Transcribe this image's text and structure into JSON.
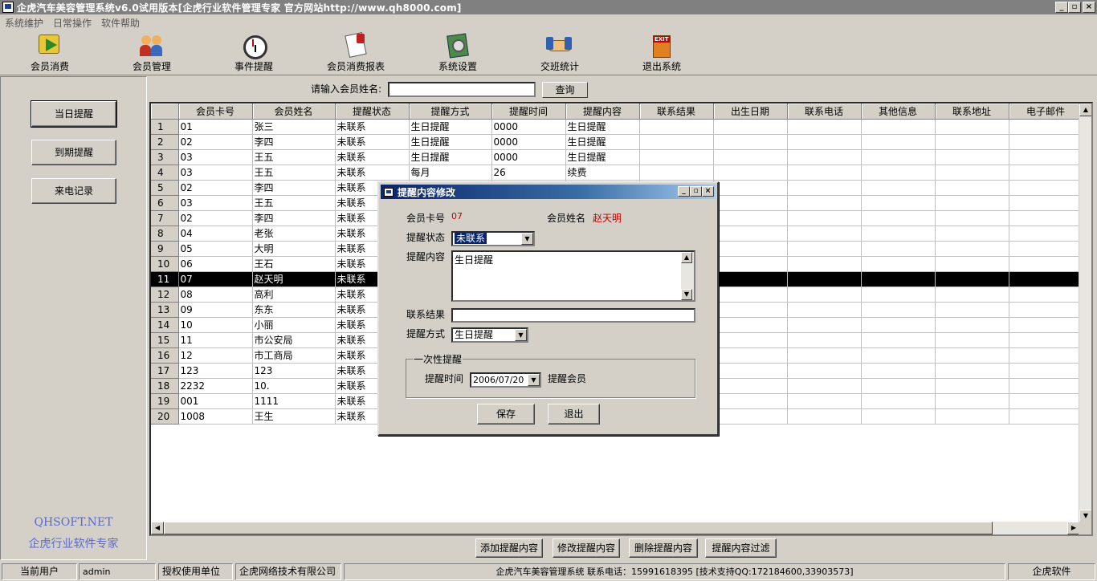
{
  "window": {
    "title": "企虎汽车美容管理系统v6.0试用版本[企虎行业软件管理专家 官方网站http://www.qh8000.com]",
    "controls": [
      "_",
      "▫",
      "×"
    ]
  },
  "menu": [
    "系统维护",
    "日常操作",
    "软件帮助"
  ],
  "toolbar": [
    {
      "label": "会员消费",
      "icon": "coin-arrow-icon"
    },
    {
      "label": "会员管理",
      "icon": "people-icon"
    },
    {
      "label": "事件提醒",
      "icon": "alarm-clock-icon"
    },
    {
      "label": "会员消费报表",
      "icon": "report-icon"
    },
    {
      "label": "系统设置",
      "icon": "settings-icon"
    },
    {
      "label": "交班统计",
      "icon": "handshake-icon"
    },
    {
      "label": "退出系统",
      "icon": "exit-door-icon"
    }
  ],
  "left": {
    "buttons": [
      "当日提醒",
      "到期提醒",
      "来电记录"
    ],
    "brand_line1": "QHSOFT.NET",
    "brand_line2": "企虎行业软件专家"
  },
  "search": {
    "label": "请输入会员姓名:",
    "value": "",
    "button": "查询"
  },
  "grid": {
    "columns": [
      "会员卡号",
      "会员姓名",
      "提醒状态",
      "提醒方式",
      "提醒时间",
      "提醒内容",
      "联系结果",
      "出生日期",
      "联系电话",
      "其他信息",
      "联系地址",
      "电子邮件"
    ],
    "selected_row": 11,
    "rows": [
      [
        "1",
        "01",
        "张三",
        "未联系",
        "生日提醒",
        "0000",
        "生日提醒"
      ],
      [
        "2",
        "02",
        "李四",
        "未联系",
        "生日提醒",
        "0000",
        "生日提醒"
      ],
      [
        "3",
        "03",
        "王五",
        "未联系",
        "生日提醒",
        "0000",
        "生日提醒"
      ],
      [
        "4",
        "03",
        "王五",
        "未联系",
        "每月",
        "26",
        "续费"
      ],
      [
        "5",
        "02",
        "李四",
        "未联系",
        "",
        "",
        ""
      ],
      [
        "6",
        "03",
        "王五",
        "未联系",
        "",
        "",
        ""
      ],
      [
        "7",
        "02",
        "李四",
        "未联系",
        "",
        "",
        ""
      ],
      [
        "8",
        "04",
        "老张",
        "未联系",
        "",
        "",
        ""
      ],
      [
        "9",
        "05",
        "大明",
        "未联系",
        "",
        "",
        ""
      ],
      [
        "10",
        "06",
        "王石",
        "未联系",
        "",
        "",
        ""
      ],
      [
        "11",
        "07",
        "赵天明",
        "未联系",
        "",
        "",
        ""
      ],
      [
        "12",
        "08",
        "高利",
        "未联系",
        "",
        "",
        ""
      ],
      [
        "13",
        "09",
        "东东",
        "未联系",
        "",
        "",
        ""
      ],
      [
        "14",
        "10",
        "小丽",
        "未联系",
        "",
        "",
        ""
      ],
      [
        "15",
        "11",
        "市公安局",
        "未联系",
        "",
        "",
        ""
      ],
      [
        "16",
        "12",
        "市工商局",
        "未联系",
        "",
        "",
        ""
      ],
      [
        "17",
        "123",
        "123",
        "未联系",
        "",
        "",
        ""
      ],
      [
        "18",
        "2232",
        "10.",
        "未联系",
        "",
        "",
        ""
      ],
      [
        "19",
        "001",
        "1111",
        "未联系",
        "",
        "",
        ""
      ],
      [
        "20",
        "1008",
        "王生",
        "未联系",
        "",
        "",
        ""
      ]
    ]
  },
  "actions": [
    "添加提醒内容",
    "修改提醒内容",
    "删除提醒内容",
    "提醒内容过滤"
  ],
  "status": {
    "user_label": "当前用户",
    "user": "admin",
    "auth_label": "授权使用单位",
    "auth_unit": "企虎网络技术有限公司",
    "info": "企虎汽车美容管理系统 联系电话：15991618395 [技术支持QQ:172184600,33903573]",
    "brand": "企虎软件"
  },
  "dialog": {
    "title": "提醒内容修改",
    "card_label": "会员卡号",
    "card_value": "07",
    "name_label": "会员姓名",
    "name_value": "赵天明",
    "state_label": "提醒状态",
    "state_value": "未联系",
    "content_label": "提醒内容",
    "content_value": "生日提醒",
    "result_label": "联系结果",
    "result_value": "",
    "method_label": "提醒方式",
    "method_value": "生日提醒",
    "group_label": "一次性提醒",
    "time_label": "提醒时间",
    "time_value": "2006/07/20",
    "notify_label": "提醒会员",
    "save": "保存",
    "exit": "退出"
  },
  "colors": {
    "face": "#d4d0c8",
    "titlebar_inactive": "#808080",
    "dialog_title": "#0a246a",
    "value_red": "#c00000",
    "brand_blue": "#5a6ad0"
  }
}
